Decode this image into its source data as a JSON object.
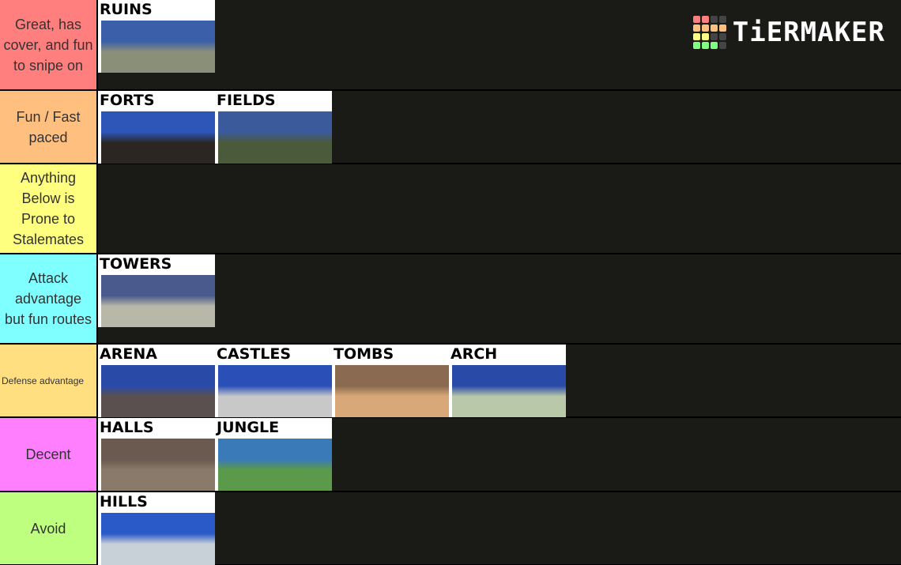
{
  "logo": {
    "text": "TiERMAKER",
    "grid_colors": [
      "#ff7f7f",
      "#ff7f7f",
      "#444444",
      "#444444",
      "#ffbf7f",
      "#ffbf7f",
      "#ffbf7f",
      "#ffbf7f",
      "#ffff7f",
      "#ffff7f",
      "#444444",
      "#444444",
      "#7fff7f",
      "#7fff7f",
      "#7fff7f",
      "#444444"
    ]
  },
  "tiers": [
    {
      "label": "Great, has cover, and fun to snipe on",
      "color": "#ff7f7f",
      "items": [
        {
          "name": "RUINS",
          "sky": "#3b5fa8",
          "ground": "#8a8f7a"
        }
      ]
    },
    {
      "label": "Fun / Fast paced",
      "color": "#ffbf7f",
      "items": [
        {
          "name": "FORTS",
          "sky": "#2d56b8",
          "ground": "#2b2622"
        },
        {
          "name": "FIELDS",
          "sky": "#3a5a9c",
          "ground": "#4a5a3a"
        }
      ]
    },
    {
      "label": "Anything Below is Prone to Stalemates",
      "color": "#ffff7f",
      "items": []
    },
    {
      "label": "Attack advantage but fun routes",
      "color": "#7fffff",
      "items": [
        {
          "name": "TOWERS",
          "sky": "#4a5a8c",
          "ground": "#b8b8a8"
        }
      ]
    },
    {
      "label": "Defense advantage",
      "color": "#ffdf80",
      "items": [
        {
          "name": "ARENA",
          "sky": "#2a4aa8",
          "ground": "#5a5050"
        },
        {
          "name": "CASTLES",
          "sky": "#2a50b8",
          "ground": "#c8c8c8"
        },
        {
          "name": "TOMBS",
          "sky": "#8a6a50",
          "ground": "#d8a878"
        },
        {
          "name": "ARCH",
          "sky": "#2a4aa8",
          "ground": "#b8c8a8"
        }
      ]
    },
    {
      "label": "Decent",
      "color": "#ff7fff",
      "items": [
        {
          "name": "HALLS",
          "sky": "#6a5a50",
          "ground": "#8a7a6a"
        },
        {
          "name": "JUNGLE",
          "sky": "#3a7ab8",
          "ground": "#5a9a4a"
        }
      ]
    },
    {
      "label": "Avoid",
      "color": "#bfff7f",
      "items": [
        {
          "name": "HILLS",
          "sky": "#2a5ac8",
          "ground": "#c8d0d8"
        }
      ]
    }
  ]
}
